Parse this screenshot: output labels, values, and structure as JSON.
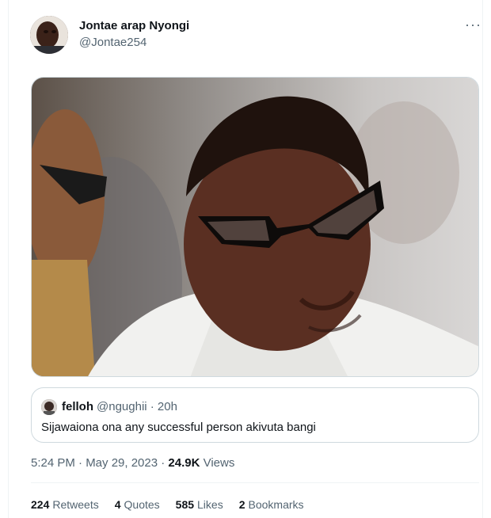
{
  "author": {
    "display_name": "Jontae arap Nyongi",
    "handle": "@Jontae254"
  },
  "more_icon": "more-dots-icon",
  "quoted_tweet": {
    "display_name": "felloh",
    "handle_time": "@ngughii · 20h",
    "text": "Sijawaiona ona any successful person akivuta bangi"
  },
  "meta": {
    "time_date": "5:24 PM · May 29, 2023 · ",
    "views_count": "24.9K",
    "views_label": " Views"
  },
  "stats": [
    {
      "count": "224",
      "label": "Retweets"
    },
    {
      "count": "4",
      "label": "Quotes"
    },
    {
      "count": "585",
      "label": "Likes"
    },
    {
      "count": "2",
      "label": "Bookmarks"
    }
  ],
  "colors": {
    "text_primary": "#0f1419",
    "text_secondary": "#536471",
    "border": "#cfd9de"
  }
}
